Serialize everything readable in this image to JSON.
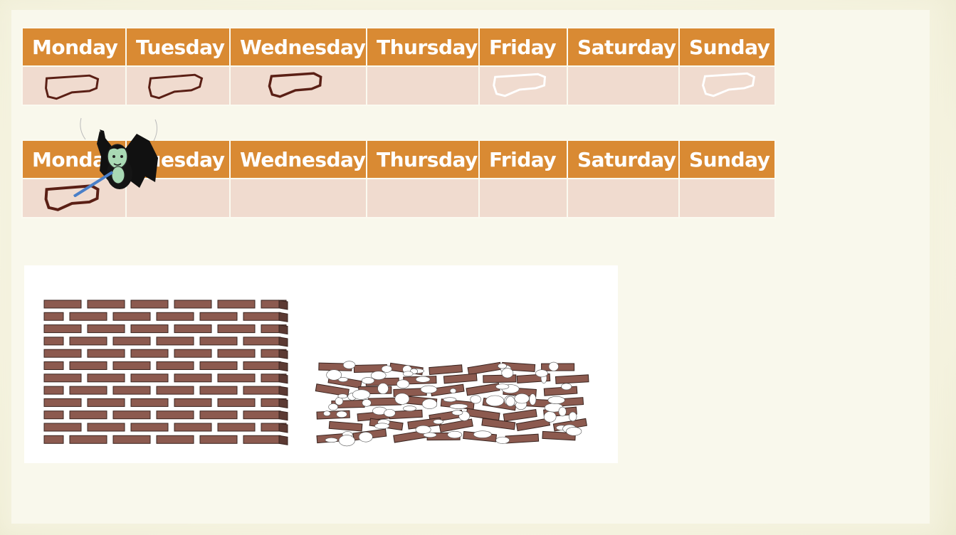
{
  "days": [
    "Monday",
    "Tuesday",
    "Wednesday",
    "Thursday",
    "Friday",
    "Saturday",
    "Sunday"
  ],
  "week1": {
    "marks": [
      "dark-rock",
      "dark-rock",
      "dark-rock",
      "none",
      "white-rock",
      "none",
      "white-rock"
    ]
  },
  "week2": {
    "marks": [
      "dark-rock",
      "none",
      "none",
      "none",
      "none",
      "none",
      "none"
    ]
  },
  "colors": {
    "header_bg": "#d98a33",
    "cell_bg": "#f0dbcf",
    "rock_dark": "#5a1f15",
    "brick": "#8c5a4f"
  },
  "images": {
    "mascot": "vampire-bat-mascot",
    "left_wall": "intact-brick-wall",
    "right_wall": "crumbling-brick-wall"
  }
}
